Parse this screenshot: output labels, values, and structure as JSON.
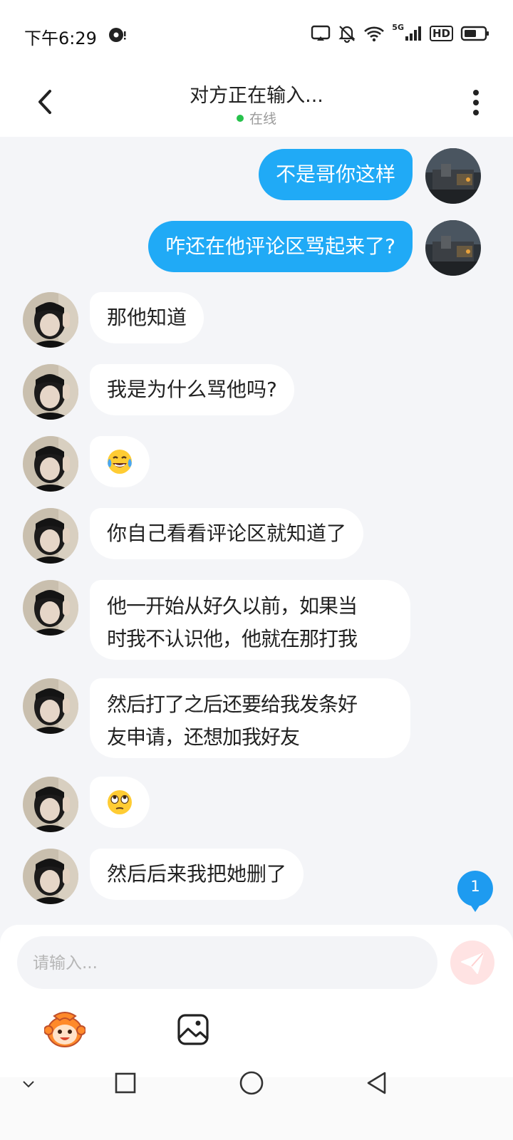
{
  "status_bar": {
    "time": "下午6:29",
    "network": "5G",
    "hd": "HD",
    "icons": [
      "media-playing-icon",
      "screen-cast-icon",
      "bell-off-icon",
      "wifi-icon",
      "signal-icon",
      "battery-icon"
    ]
  },
  "header": {
    "title": "对方正在输入...",
    "status": "在线",
    "back_icon": "chevron-left-icon",
    "more_icon": "more-vertical-icon",
    "online_color": "#27c24c"
  },
  "messages": [
    {
      "side": "out",
      "text": "不是哥你这样"
    },
    {
      "side": "out",
      "text": "咋还在他评论区骂起来了?"
    },
    {
      "side": "in",
      "lines": [
        "那他知道"
      ]
    },
    {
      "side": "in",
      "lines": [
        "我是为什么骂他吗?"
      ]
    },
    {
      "side": "in",
      "emoji": "tears-of-joy-emoji"
    },
    {
      "side": "in",
      "lines": [
        "你自己看看评论区就知道了"
      ]
    },
    {
      "side": "in",
      "lines": [
        "他一开始从好久以前，如果当",
        "时我不认识他，他就在那打我"
      ]
    },
    {
      "side": "in",
      "lines": [
        "然后打了之后还要给我发条好",
        "友申请，还想加我好友"
      ]
    },
    {
      "side": "in",
      "emoji": "eye-roll-emoji"
    },
    {
      "side": "in",
      "lines": [
        "然后后来我把她删了"
      ]
    }
  ],
  "unread_badge": "1",
  "input": {
    "placeholder": "请输入...",
    "value": "",
    "send_icon": "send-icon",
    "emoji_icon": "monkey-emoji-icon",
    "image_icon": "image-icon"
  },
  "colors": {
    "outgoing_bubble": "#20aaf6",
    "incoming_bubble": "#ffffff",
    "background": "#f4f5f8",
    "badge": "#1e9bf0"
  },
  "navbar": {
    "items": [
      "collapse-nav-icon",
      "recents-icon",
      "home-icon",
      "back-icon"
    ]
  }
}
